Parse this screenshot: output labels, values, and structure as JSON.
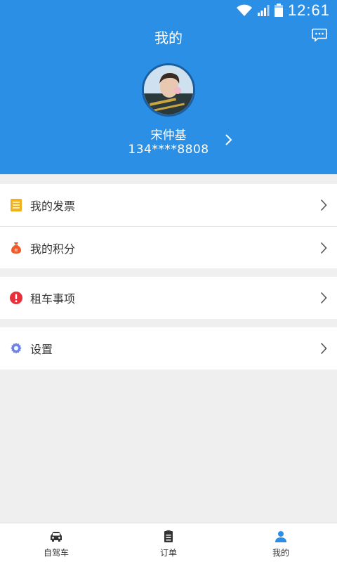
{
  "status_bar": {
    "time": "12:61"
  },
  "header": {
    "title": "我的",
    "user_name": "宋仲基",
    "phone": "134****8808",
    "background_color": "#2b8fe6"
  },
  "menu": {
    "group1": [
      {
        "label": "我的发票",
        "icon": "invoice-icon",
        "icon_color": "#f3b01e"
      },
      {
        "label": "我的积分",
        "icon": "points-bag-icon",
        "icon_color": "#f05a28"
      }
    ],
    "group2": [
      {
        "label": "租车事项",
        "icon": "alert-icon",
        "icon_color": "#e8303a"
      }
    ],
    "group3": [
      {
        "label": "设置",
        "icon": "gear-icon",
        "icon_color": "#6b83e8"
      }
    ]
  },
  "tabbar": {
    "items": [
      {
        "label": "自驾车",
        "icon": "car-icon"
      },
      {
        "label": "订单",
        "icon": "order-list-icon"
      },
      {
        "label": "我的",
        "icon": "user-icon",
        "active": true
      }
    ],
    "active_color": "#2b8fe6"
  }
}
